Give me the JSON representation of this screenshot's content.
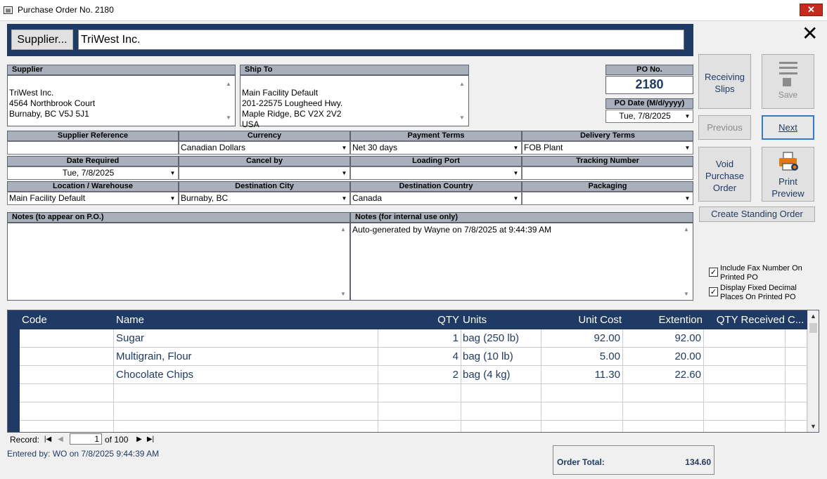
{
  "window": {
    "title": "Purchase Order No. 2180",
    "close_label": "✕"
  },
  "header": {
    "supplier_button": "Supplier...",
    "supplier_name": "TriWest Inc."
  },
  "supplier": {
    "label": "Supplier",
    "address": "TriWest Inc.\n4564 Northbrook Court\nBurnaby, BC  V5J 5J1"
  },
  "ship_to": {
    "label": "Ship To",
    "address": "Main Facility Default\n201-22575 Lougheed Hwy.\nMaple Ridge, BC  V2X 2V2\nUSA"
  },
  "po": {
    "no_label": "PO No.",
    "no": "2180",
    "date_label": "PO Date (M/d/yyyy)",
    "date": "Tue, 7/8/2025"
  },
  "fields": {
    "supplier_reference": {
      "label": "Supplier Reference",
      "value": ""
    },
    "currency": {
      "label": "Currency",
      "value": "Canadian Dollars"
    },
    "payment_terms": {
      "label": "Payment Terms",
      "value": "Net 30 days"
    },
    "delivery_terms": {
      "label": "Delivery Terms",
      "value": "FOB Plant"
    },
    "date_required": {
      "label": "Date Required",
      "value": "Tue, 7/8/2025"
    },
    "cancel_by": {
      "label": "Cancel by",
      "value": ""
    },
    "loading_port": {
      "label": "Loading Port",
      "value": ""
    },
    "tracking_number": {
      "label": "Tracking Number",
      "value": ""
    },
    "location": {
      "label": "Location / Warehouse",
      "value": "Main Facility Default"
    },
    "destination_city": {
      "label": "Destination City",
      "value": "Burnaby, BC"
    },
    "destination_country": {
      "label": "Destination Country",
      "value": "Canada"
    },
    "packaging": {
      "label": "Packaging",
      "value": ""
    }
  },
  "notes": {
    "po_label": "Notes (to appear on P.O.)",
    "po_value": "",
    "internal_label": "Notes (for internal use only)",
    "internal_value": "Auto-generated by Wayne on 7/8/2025 at 9:44:39 AM"
  },
  "actions": {
    "receiving_slips": "Receiving Slips",
    "save": "Save",
    "previous": "Previous",
    "next": "Next",
    "void": "Void Purchase Order",
    "print_preview": "Print Preview",
    "create_standing": "Create Standing Order",
    "include_fax": "Include Fax Number On Printed PO",
    "display_fixed": "Display Fixed Decimal Places On Printed PO",
    "include_fax_checked": true,
    "display_fixed_checked": true
  },
  "grid": {
    "columns": [
      "Code",
      "Name",
      "QTY",
      "Units",
      "Unit Cost",
      "Extention",
      "QTY Received",
      "C..."
    ],
    "rows": [
      {
        "code": "",
        "name": "Sugar",
        "qty": "1",
        "units": "bag (250 lb)",
        "unit_cost": "92.00",
        "extension": "92.00",
        "qty_received": ""
      },
      {
        "code": "",
        "name": "Multigrain, Flour",
        "qty": "4",
        "units": "bag (10 lb)",
        "unit_cost": "5.00",
        "extension": "20.00",
        "qty_received": ""
      },
      {
        "code": "",
        "name": "Chocolate Chips",
        "qty": "2",
        "units": "bag (4 kg)",
        "unit_cost": "11.30",
        "extension": "22.60",
        "qty_received": ""
      }
    ]
  },
  "nav": {
    "record_label": "Record:",
    "current": "1",
    "of_total": "of 100"
  },
  "footer": {
    "entered": "Entered by: WO on 7/8/2025 9:44:39 AM",
    "total_label": "Order Total:",
    "total_value": "134.60"
  },
  "colors": {
    "header_navy": "#1f3a64",
    "section_gray": "#a9b0bc",
    "close_red": "#c42b1c",
    "print_orange": "#e07a10"
  }
}
